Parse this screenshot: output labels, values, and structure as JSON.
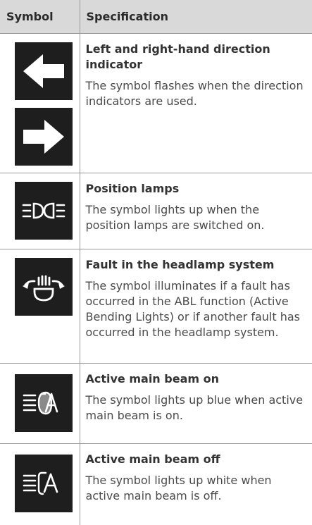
{
  "header": {
    "symbol": "Symbol",
    "specification": "Specification"
  },
  "rows": [
    {
      "title": "Left and right-hand direction indicator",
      "body": "The symbol flashes when the direction indicators are used.",
      "icons": [
        "arrow-left-icon",
        "arrow-right-icon"
      ]
    },
    {
      "title": "Position lamps",
      "body": "The symbol lights up when the position lamps are switched on.",
      "icons": [
        "position-lamps-icon"
      ]
    },
    {
      "title": "Fault in the headlamp system",
      "body": "The symbol illuminates if a fault has occurred in the ABL function (Active Bending Lights) or if another fault has occurred in the headlamp system.",
      "icons": [
        "headlamp-fault-icon"
      ]
    },
    {
      "title": "Active main beam on",
      "body": "The symbol lights up blue when active main beam is on.",
      "icons": [
        "active-main-beam-on-icon"
      ]
    },
    {
      "title": "Active main beam off",
      "body": "The symbol lights up white when active main beam is off.",
      "icons": [
        "active-main-beam-off-icon"
      ]
    }
  ],
  "colors": {
    "header_bg": "#d9d9d9",
    "icon_bg": "#1e1e1e",
    "icon_fg": "#ffffff",
    "beam_fill": "#7a7a7a"
  }
}
